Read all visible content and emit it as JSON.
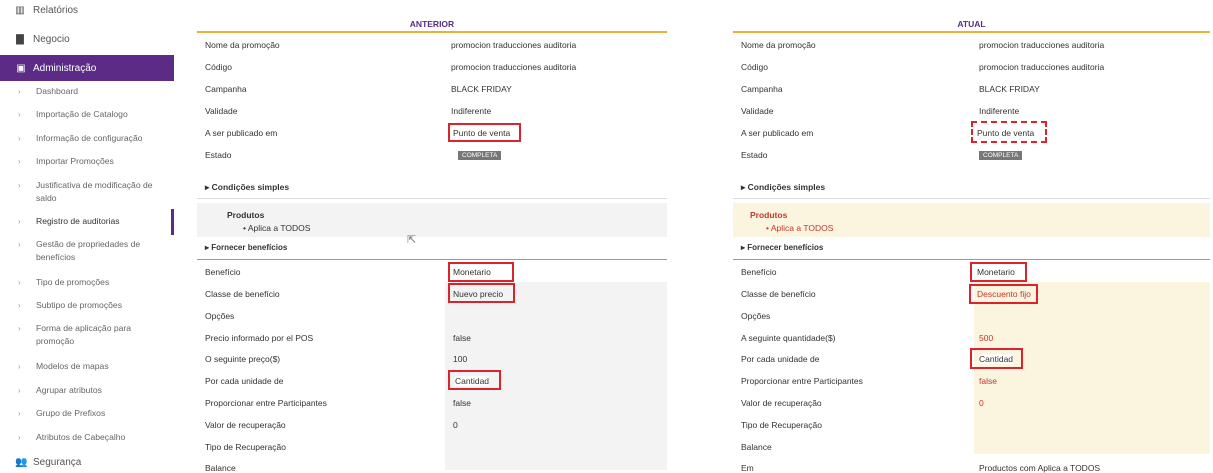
{
  "sidebar": {
    "top_items": [
      {
        "label": "Relatórios",
        "icon": "chart-icon"
      },
      {
        "label": "Negocio",
        "icon": "building-icon"
      }
    ],
    "active_section": {
      "label": "Administração",
      "icon": "calendar-icon"
    },
    "items": [
      {
        "label": "Dashboard"
      },
      {
        "label": "Importação de Catalogo"
      },
      {
        "label": "Informação de configuração"
      },
      {
        "label": "Importar Promoções"
      },
      {
        "label": "Justificativa de modificação de saldo"
      },
      {
        "label": "Registro de auditorias"
      },
      {
        "label": "Gestão de propriedades de benefícios"
      },
      {
        "label": "Tipo de promoções"
      },
      {
        "label": "Subtipo de promoções"
      },
      {
        "label": "Forma de aplicação para promoção"
      },
      {
        "label": "Modelos de mapas"
      },
      {
        "label": "Agrupar atributos"
      },
      {
        "label": "Grupo de Prefixos"
      },
      {
        "label": "Atributos de Cabeçalho"
      }
    ],
    "bottom_item": {
      "label": "Segurança",
      "icon": "users-icon"
    }
  },
  "anterior": {
    "title": "ANTERIOR",
    "fields": [
      {
        "label": "Nome da promoção",
        "value": "promocion traducciones auditoria"
      },
      {
        "label": "Código",
        "value": "promocion traducciones auditoria"
      },
      {
        "label": "Campanha",
        "value": "BLACK FRIDAY"
      },
      {
        "label": "Validade",
        "value": "Indiferente"
      },
      {
        "label": "A ser publicado em",
        "value": "Punto de venta"
      },
      {
        "label": "Estado",
        "value": "COMPLETA"
      }
    ],
    "cond_title": "Condições simples",
    "produtos_title": "Produtos",
    "produtos_item": "Aplica a TODOS",
    "benef_title": "Fornecer benefícios",
    "benefits": [
      {
        "label": "Benefício",
        "value": "Monetario"
      },
      {
        "label": "Classe de benefício",
        "value": "Nuevo precio"
      },
      {
        "label": "Opções",
        "value": ""
      },
      {
        "label": "Precio informado por el POS",
        "value": "false"
      },
      {
        "label": "O seguinte preço($)",
        "value": "100"
      },
      {
        "label": "Por cada unidade de",
        "value": "Cantidad"
      },
      {
        "label": "Proporcionar entre Participantes",
        "value": "false"
      },
      {
        "label": "Valor de recuperação",
        "value": "0"
      },
      {
        "label": "Tipo de Recuperação",
        "value": ""
      },
      {
        "label": "Balance",
        "value": ""
      }
    ]
  },
  "atual": {
    "title": "ATUAL",
    "fields": [
      {
        "label": "Nome da promoção",
        "value": "promocion traducciones auditoria"
      },
      {
        "label": "Código",
        "value": "promocion traducciones auditoria"
      },
      {
        "label": "Campanha",
        "value": "BLACK FRIDAY"
      },
      {
        "label": "Validade",
        "value": "Indiferente"
      },
      {
        "label": "A ser publicado em",
        "value": "Punto de venta"
      },
      {
        "label": "Estado",
        "value": "COMPLETA"
      }
    ],
    "cond_title": "Condições simples",
    "produtos_title": "Produtos",
    "produtos_item": "Aplica a TODOS",
    "benef_title": "Fornecer benefícios",
    "benefits": [
      {
        "label": "Benefício",
        "value": "Monetario"
      },
      {
        "label": "Classe de benefício",
        "value": "Descuento fijo"
      },
      {
        "label": "Opções",
        "value": ""
      },
      {
        "label": "A seguinte quantidade($)",
        "value": "500"
      },
      {
        "label": "Por cada unidade de",
        "value": "Cantidad"
      },
      {
        "label": "Proporcionar entre Participantes",
        "value": "false"
      },
      {
        "label": "Valor de recuperação",
        "value": "0"
      },
      {
        "label": "Tipo de Recuperação",
        "value": ""
      },
      {
        "label": "Balance",
        "value": ""
      },
      {
        "label": "Em",
        "value": "Productos com Aplica a TODOS"
      }
    ]
  },
  "colors": {
    "accent": "#5b2b86",
    "underline": "#e8b23a",
    "highlight": "#d9232d",
    "changed_bg": "#fbf4df"
  }
}
